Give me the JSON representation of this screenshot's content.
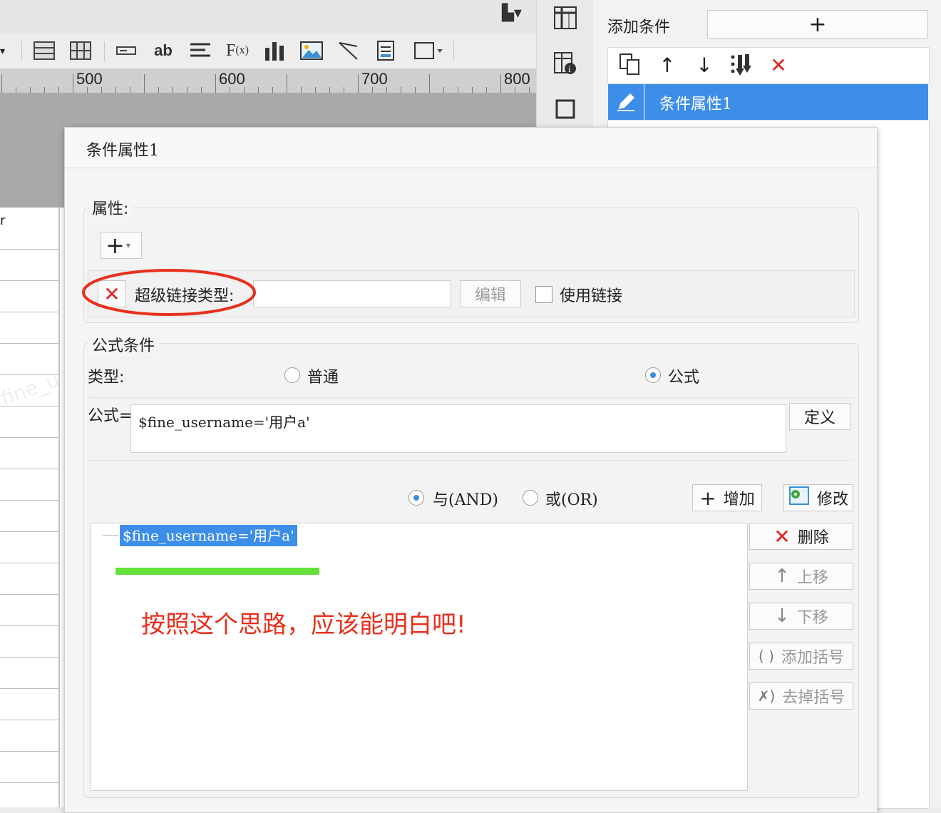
{
  "background": {
    "ruler_labels": [
      "500",
      "600",
      "700",
      "800"
    ],
    "toolbar_icons": [
      "table-icon",
      "grid-icon",
      "textbox-icon",
      "ab-text-icon",
      "align-icon",
      "formula-icon",
      "bar-chart-icon",
      "image-icon",
      "slash-icon",
      "page-icon",
      "border-icon"
    ],
    "side_icons": [
      "freeze-icon",
      "cell-info-icon",
      "frame-icon"
    ],
    "watermark": "fine_u"
  },
  "right_panel": {
    "add_condition_label": "添加条件",
    "add_button_label": "+",
    "toolbar_icons": [
      "copy-icon",
      "move-up-icon",
      "move-down-icon",
      "move-bottom-icon",
      "delete-icon"
    ],
    "selected_item": "条件属性1"
  },
  "dialog": {
    "title": "条件属性1",
    "attributes": {
      "legend": "属性:",
      "add_button": "+",
      "hyperlink_label": "超级链接类型:",
      "hyperlink_value": "",
      "edit_button": "编辑",
      "use_link_label": "使用链接",
      "use_link_checked": false
    },
    "formula_condition": {
      "legend": "公式条件",
      "type_label": "类型:",
      "type_normal": "普通",
      "type_formula": "公式",
      "selected_type": "公式",
      "formula_label": "公式=",
      "formula_value": "$fine_username='用户a'",
      "define_button": "定义",
      "and_label": "与(AND)",
      "or_label": "或(OR)",
      "selected_logic": "与(AND)",
      "add_button": "增加",
      "modify_button": "修改",
      "tree_item": "$fine_username='用户a'",
      "delete_button": "删除",
      "move_up_button": "上移",
      "move_down_button": "下移",
      "add_parens_button": "添加括号",
      "remove_parens_button": "去掉括号"
    },
    "annotation_text": "按照这个思路，应该能明白吧!"
  },
  "colors": {
    "selection_blue": "#3d8ee8",
    "annotation_red": "#e8301c",
    "highlight_green": "#63e03a",
    "delete_red": "#e02424"
  }
}
